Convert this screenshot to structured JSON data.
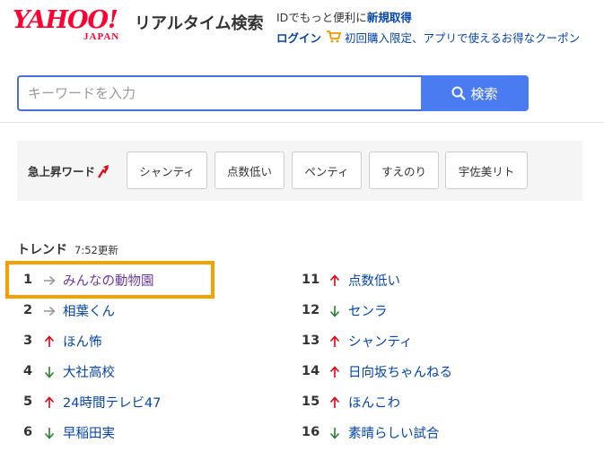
{
  "header": {
    "logo_main": "YAHOO!",
    "logo_sub": "JAPAN",
    "service_name": "リアルタイム検索",
    "line1_prefix": "IDでもっと便利に",
    "line1_link": "新規取得",
    "login": "ログイン",
    "promo": "初回購入限定、アプリで使えるお得なクーポン"
  },
  "search": {
    "placeholder": "キーワードを入力",
    "value": "",
    "button_label": "検索"
  },
  "rising": {
    "label": "急上昇ワード",
    "words": [
      "シャンティ",
      "点数低い",
      "ペンティ",
      "すえのり",
      "宇佐美リト"
    ]
  },
  "trend": {
    "title": "トレンド",
    "updated": "7:52更新",
    "items": [
      {
        "rank": "1",
        "arrow": "right",
        "word": "みんなの動物園"
      },
      {
        "rank": "2",
        "arrow": "right",
        "word": "相葉くん"
      },
      {
        "rank": "3",
        "arrow": "up",
        "word": "ほん怖"
      },
      {
        "rank": "4",
        "arrow": "down",
        "word": "大社高校"
      },
      {
        "rank": "5",
        "arrow": "up",
        "word": "24時間テレビ47"
      },
      {
        "rank": "6",
        "arrow": "down",
        "word": "早稲田実"
      },
      {
        "rank": "11",
        "arrow": "up",
        "word": "点数低い"
      },
      {
        "rank": "12",
        "arrow": "down",
        "word": "センラ"
      },
      {
        "rank": "13",
        "arrow": "up",
        "word": "シャンティ"
      },
      {
        "rank": "14",
        "arrow": "up",
        "word": "日向坂ちゃんねる"
      },
      {
        "rank": "15",
        "arrow": "up",
        "word": "ほんこわ"
      },
      {
        "rank": "16",
        "arrow": "down",
        "word": "素晴らしい試合"
      }
    ]
  },
  "colors": {
    "brand": "#ff0033",
    "link": "#0645ad",
    "search_button": "#4a7bf0",
    "arrow_up": "#e60012",
    "arrow_down": "#2e7d32",
    "arrow_right": "#999999",
    "highlight": "#f5a100"
  }
}
